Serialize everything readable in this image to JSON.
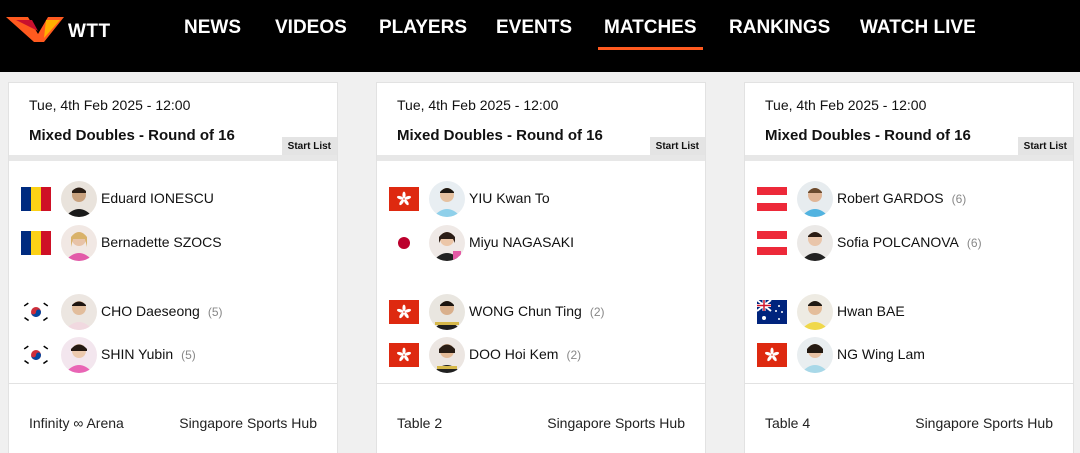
{
  "brand": {
    "name": "WTT"
  },
  "nav": {
    "items": [
      {
        "label": "NEWS"
      },
      {
        "label": "VIDEOS"
      },
      {
        "label": "PLAYERS"
      },
      {
        "label": "EVENTS"
      },
      {
        "label": "MATCHES",
        "active": true
      },
      {
        "label": "RANKINGS"
      },
      {
        "label": "WATCH LIVE"
      }
    ],
    "accent_color": "#ff5a1f"
  },
  "matches": [
    {
      "date": "Tue, 4th Feb 2025 - 12:00",
      "title": "Mixed Doubles - Round of 16",
      "start_list_label": "Start List",
      "team1": [
        {
          "name": "Eduard IONESCU",
          "seed": "",
          "flag": "romania"
        },
        {
          "name": "Bernadette SZOCS",
          "seed": "",
          "flag": "romania"
        }
      ],
      "team2": [
        {
          "name": "CHO Daeseong",
          "seed": "(5)",
          "flag": "south-korea"
        },
        {
          "name": "SHIN Yubin",
          "seed": "(5)",
          "flag": "south-korea"
        }
      ],
      "table": "Infinity ∞ Arena",
      "venue": "Singapore Sports Hub"
    },
    {
      "date": "Tue, 4th Feb 2025 - 12:00",
      "title": "Mixed Doubles - Round of 16",
      "start_list_label": "Start List",
      "team1": [
        {
          "name": "YIU Kwan To",
          "seed": "",
          "flag": "hong-kong"
        },
        {
          "name": "Miyu NAGASAKI",
          "seed": "",
          "flag": "japan"
        }
      ],
      "team2": [
        {
          "name": "WONG Chun Ting",
          "seed": "(2)",
          "flag": "hong-kong"
        },
        {
          "name": "DOO Hoi Kem",
          "seed": "(2)",
          "flag": "hong-kong"
        }
      ],
      "table": "Table 2",
      "venue": "Singapore Sports Hub"
    },
    {
      "date": "Tue, 4th Feb 2025 - 12:00",
      "title": "Mixed Doubles - Round of 16",
      "start_list_label": "Start List",
      "team1": [
        {
          "name": "Robert GARDOS",
          "seed": "(6)",
          "flag": "austria"
        },
        {
          "name": "Sofia POLCANOVA",
          "seed": "(6)",
          "flag": "austria"
        }
      ],
      "team2": [
        {
          "name": "Hwan BAE",
          "seed": "",
          "flag": "australia"
        },
        {
          "name": "NG Wing Lam",
          "seed": "",
          "flag": "hong-kong"
        }
      ],
      "table": "Table 4",
      "venue": "Singapore Sports Hub"
    }
  ]
}
